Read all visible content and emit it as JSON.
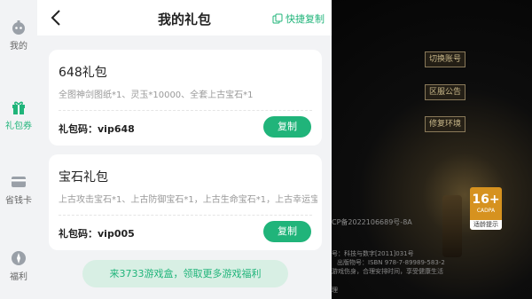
{
  "sidebar": {
    "items": [
      {
        "label": "我的",
        "icon": "profile-icon",
        "active": false
      },
      {
        "label": "礼包券",
        "icon": "gift-icon",
        "active": true
      },
      {
        "label": "省钱卡",
        "icon": "card-icon",
        "active": false
      },
      {
        "label": "福利",
        "icon": "compass-icon",
        "active": false
      }
    ]
  },
  "header": {
    "title": "我的礼包",
    "quick_copy": "快捷复制"
  },
  "gifts": [
    {
      "name": "648礼包",
      "desc": "全图神剑图纸*1、灵玉*10000、全套上古宝石*1",
      "code": "礼包码：vip648",
      "copy": "复制"
    },
    {
      "name": "宝石礼包",
      "desc": "上古攻击宝石*1、上古防御宝石*1，上古生命宝石*1，上古幸运宝",
      "code": "礼包码：vip005",
      "copy": "复制"
    }
  ],
  "promo": "来3733游戏盒，领取更多游戏福利",
  "game": {
    "buttons": [
      "切换账号",
      "区服公告",
      "修复环境"
    ],
    "rating": {
      "age": "16+",
      "sub": "CADPA",
      "tip": "适龄提示"
    },
    "icp": "CP备2022106689号-8A",
    "lines": [
      "号：科技与数字[2011]031号",
      "出版物号：ISBN 978-7-89989-583-2",
      "游戏伤身，合理安排时间，享受健康生活",
      "理"
    ]
  },
  "colors": {
    "accent": "#20b47a",
    "bg": "#f2f3f5"
  }
}
